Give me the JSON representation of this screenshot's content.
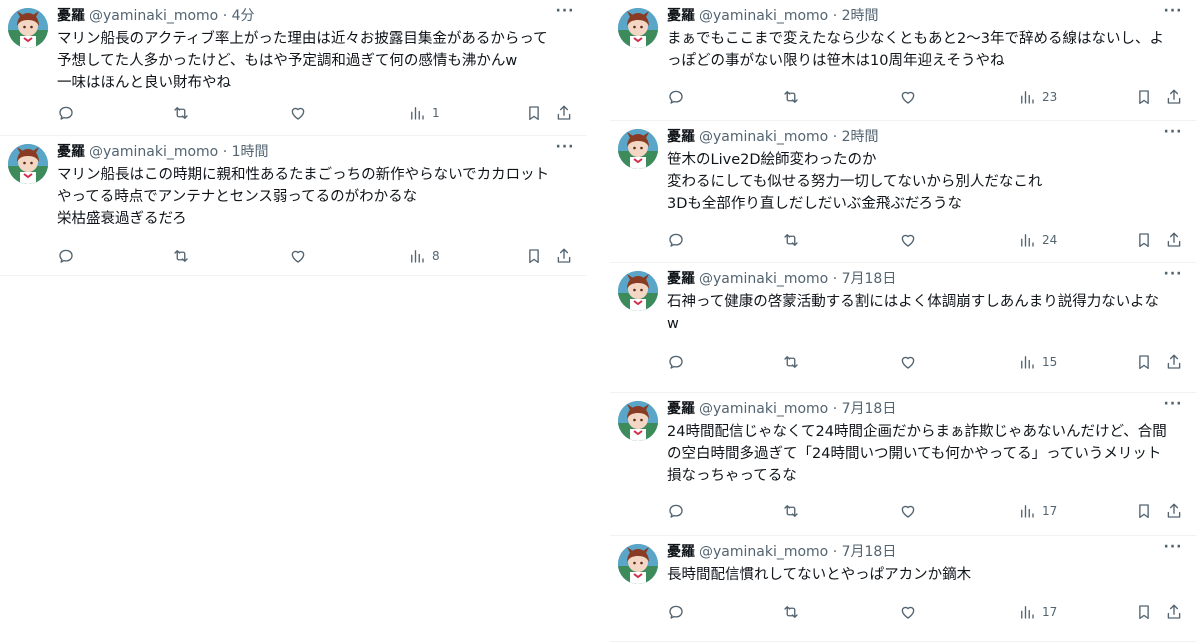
{
  "tweets_left": [
    {
      "name": "憂羅",
      "handle": "@yaminaki_momo",
      "time": "· 4分",
      "text": "マリン船長のアクティブ率上がった理由は近々お披露目集金があるからって\n予想してた人多かったけど、もはや予定調和過ぎて何の感情も沸かんw\n一味はほんと良い財布やね",
      "views": "1"
    },
    {
      "name": "憂羅",
      "handle": "@yaminaki_momo",
      "time": "· 1時間",
      "text": "マリン船長はこの時期に親和性あるたまごっちの新作やらないでカカロット\nやってる時点でアンテナとセンス弱ってるのがわかるな\n栄枯盛衰過ぎるだろ",
      "views": "8"
    }
  ],
  "tweets_right": [
    {
      "name": "憂羅",
      "handle": "@yaminaki_momo",
      "time": "· 2時間",
      "text": "まぁでもここまで変えたなら少なくともあと2〜3年で辞める線はないし、よ\nっぽどの事がない限りは笹木は10周年迎えそうやね",
      "views": "23"
    },
    {
      "name": "憂羅",
      "handle": "@yaminaki_momo",
      "time": "· 2時間",
      "text": "笹木のLive2D絵師変わったのか\n変わるにしても似せる努力一切してないから別人だなこれ\n3Dも全部作り直しだしだいぶ金飛ぶだろうな",
      "views": "24"
    },
    {
      "name": "憂羅",
      "handle": "@yaminaki_momo",
      "time": "· 7月18日",
      "text": "石神って健康の啓蒙活動する割にはよく体調崩すしあんまり説得力ないよな\nw",
      "views": "15"
    },
    {
      "name": "憂羅",
      "handle": "@yaminaki_momo",
      "time": "· 7月18日",
      "text": "24時間配信じゃなくて24時間企画だからまぁ詐欺じゃあないんだけど、合間\nの空白時間多過ぎて「24時間いつ開いても何かやってる」っていうメリット\n損なっちゃってるな",
      "views": "17"
    },
    {
      "name": "憂羅",
      "handle": "@yaminaki_momo",
      "time": "· 7月18日",
      "text": "長時間配信慣れしてないとやっぱアカンか鏑木",
      "views": "17"
    }
  ],
  "more_label": "···",
  "icons": [
    "reply-icon",
    "retweet-icon",
    "like-icon",
    "views-icon",
    "bookmark-icon",
    "share-icon"
  ],
  "colors": {
    "text": "#0f1419",
    "muted": "#536471",
    "divider": "#eff3f4"
  }
}
